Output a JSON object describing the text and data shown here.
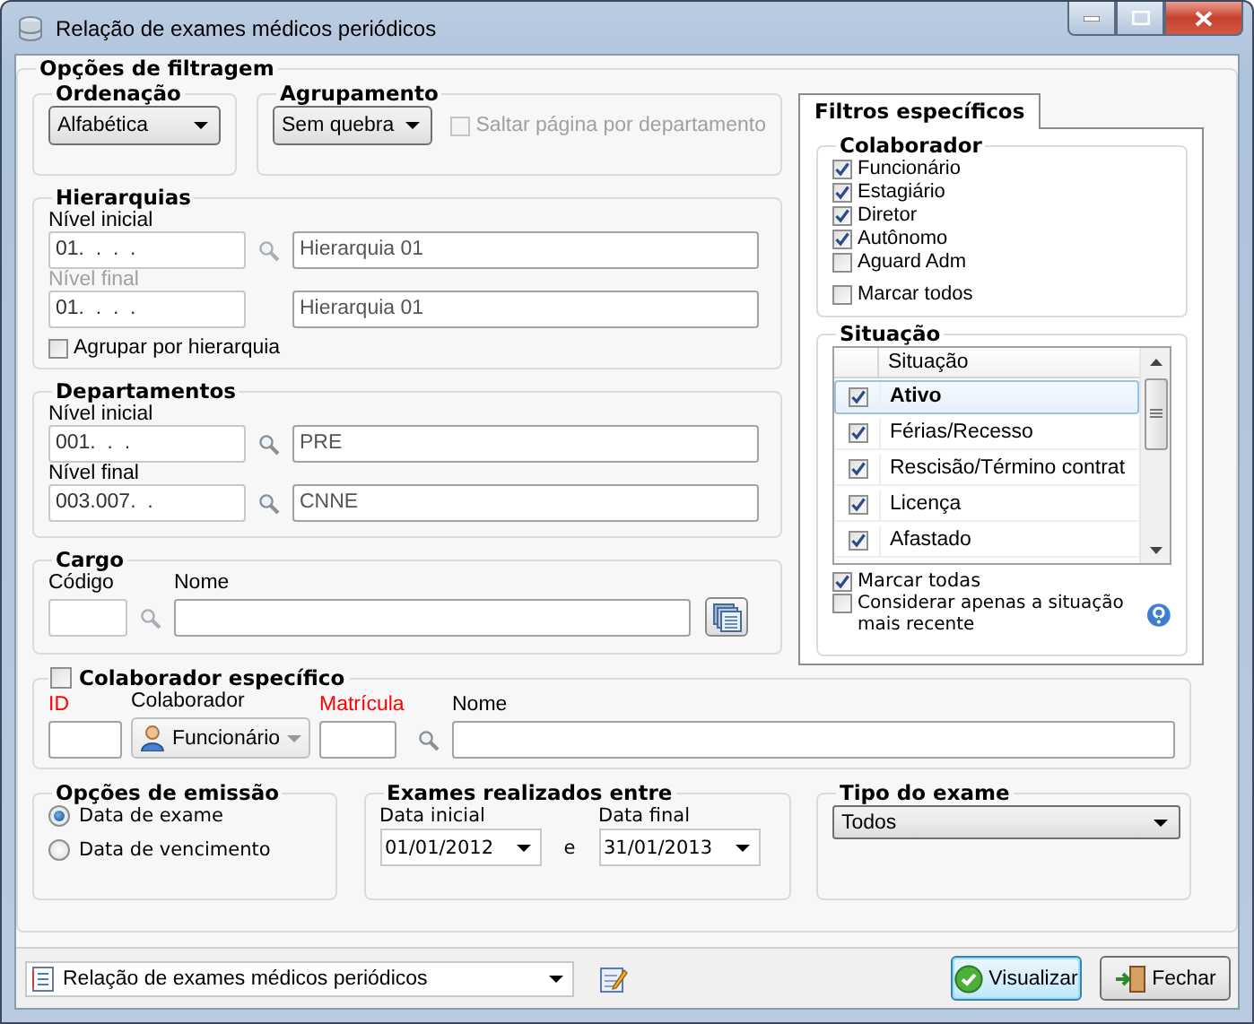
{
  "window": {
    "title": "Relação de exames médicos periódicos"
  },
  "filter_options": {
    "title": "Opções de filtragem",
    "ordering": {
      "title": "Ordenação",
      "value": "Alfabética"
    },
    "grouping": {
      "title": "Agrupamento",
      "value": "Sem quebra",
      "skip_page": {
        "label": "Saltar página por departamento",
        "checked": false,
        "disabled": true
      }
    },
    "hierarchies": {
      "title": "Hierarquias",
      "start": {
        "label": "Nível inicial",
        "code": "01.  .  .  .",
        "name": "Hierarquia 01",
        "disabled": false
      },
      "end": {
        "label": "Nível final",
        "code": "01.  .  .  .",
        "name": "Hierarquia 01",
        "disabled": true
      },
      "group_by": {
        "label": "Agrupar por hierarquia",
        "checked": false
      }
    },
    "departments": {
      "title": "Departamentos",
      "start": {
        "label": "Nível inicial",
        "code": "001.  .  .",
        "name": "PRE",
        "disabled": false
      },
      "end": {
        "label": "Nível final",
        "code": "003.007.  .",
        "name": "CNNE",
        "disabled": false
      }
    },
    "position": {
      "title": "Cargo",
      "code_label": "Código",
      "name_label": "Nome"
    },
    "specific_collaborator": {
      "title": "Colaborador específico",
      "checked": false,
      "id_label": "ID",
      "type_label": "Colaborador",
      "type_value": "Funcionário",
      "registration_label": "Matrícula",
      "name_label": "Nome"
    },
    "emission": {
      "title": "Opções de emissão",
      "options": [
        {
          "label": "Data de exame",
          "selected": true
        },
        {
          "label": "Data de vencimento",
          "selected": false
        }
      ]
    },
    "period": {
      "title": "Exames realizados entre",
      "start_label": "Data inicial",
      "start": "01/01/2012",
      "separator": "e",
      "end_label": "Data final",
      "end": "31/01/2013"
    },
    "exam_type": {
      "title": "Tipo do exame",
      "value": "Todos"
    }
  },
  "specific_filters": {
    "tab": "Filtros específicos",
    "collaborator": {
      "title": "Colaborador",
      "items": [
        {
          "label": "Funcionário",
          "checked": true
        },
        {
          "label": "Estagiário",
          "checked": true
        },
        {
          "label": "Diretor",
          "checked": true
        },
        {
          "label": "Autônomo",
          "checked": true
        },
        {
          "label": "Aguard Adm",
          "checked": false
        }
      ],
      "mark_all": {
        "label": "Marcar todos",
        "checked": false
      }
    },
    "status": {
      "title": "Situação",
      "column": "Situação",
      "rows": [
        {
          "label": "Ativo",
          "checked": true,
          "selected": true
        },
        {
          "label": "Férias/Recesso",
          "checked": true,
          "selected": false
        },
        {
          "label": "Rescisão/Término contrat",
          "checked": true,
          "selected": false
        },
        {
          "label": "Licença",
          "checked": true,
          "selected": false
        },
        {
          "label": "Afastado",
          "checked": true,
          "selected": false
        }
      ],
      "mark_all": {
        "label": "Marcar todas",
        "checked": true
      },
      "latest_only": {
        "label": "Considerar apenas a situação mais recente",
        "checked": false
      }
    }
  },
  "footer": {
    "report": "Relação de exames médicos periódicos",
    "buttons": [
      {
        "label": "Visualizar",
        "kind": "preview"
      },
      {
        "label": "Fechar",
        "kind": "close"
      }
    ]
  }
}
